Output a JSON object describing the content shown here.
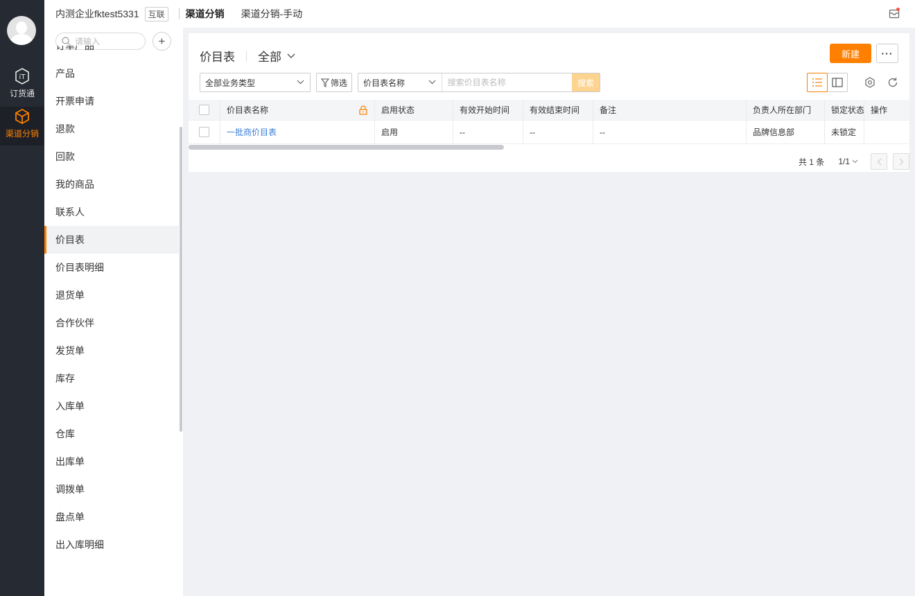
{
  "rail": {
    "items": [
      {
        "label": "订货通",
        "icon": "shield-it-icon"
      },
      {
        "label": "渠道分销",
        "icon": "box-icon",
        "active": true
      }
    ]
  },
  "header": {
    "company": "内测企业fktest5331",
    "badge": "互联",
    "breadcrumb": [
      "渠道分销",
      "渠道分销-手动"
    ]
  },
  "sidebar": {
    "search_placeholder": "请输入",
    "add_label": "+",
    "items": [
      {
        "label": "订单产品"
      },
      {
        "label": "产品"
      },
      {
        "label": "开票申请"
      },
      {
        "label": "退款"
      },
      {
        "label": "回款"
      },
      {
        "label": "我的商品"
      },
      {
        "label": "联系人"
      },
      {
        "label": "价目表",
        "active": true
      },
      {
        "label": "价目表明细"
      },
      {
        "label": "退货单"
      },
      {
        "label": "合作伙伴"
      },
      {
        "label": "发货单"
      },
      {
        "label": "库存"
      },
      {
        "label": "入库单"
      },
      {
        "label": "仓库"
      },
      {
        "label": "出库单"
      },
      {
        "label": "调拨单"
      },
      {
        "label": "盘点单"
      },
      {
        "label": "出入库明细"
      }
    ]
  },
  "main": {
    "title": "价目表",
    "scope": "全部",
    "new_label": "新建",
    "more_label": "···",
    "filters": {
      "biz_type": "全部业务类型",
      "filter_label": "筛选",
      "search_field": "价目表名称",
      "search_placeholder": "搜索价目表名称",
      "search_button": "搜索"
    },
    "table": {
      "columns": [
        "价目表名称",
        "启用状态",
        "有效开始时间",
        "有效结束时间",
        "备注",
        "负责人所在部门",
        "锁定状态",
        "操作"
      ],
      "rows": [
        {
          "name": "一批商价目表",
          "status": "启用",
          "start": "--",
          "end": "--",
          "remark": "--",
          "dept": "品牌信息部",
          "lock": "未锁定",
          "op": ""
        }
      ]
    },
    "pager": {
      "total": "共 1 条",
      "pages": "1/1"
    }
  },
  "colors": {
    "accent": "#ff8000",
    "rail_bg": "#262a33",
    "link": "#3b7dd8",
    "search_btn": "#fcd38f"
  }
}
